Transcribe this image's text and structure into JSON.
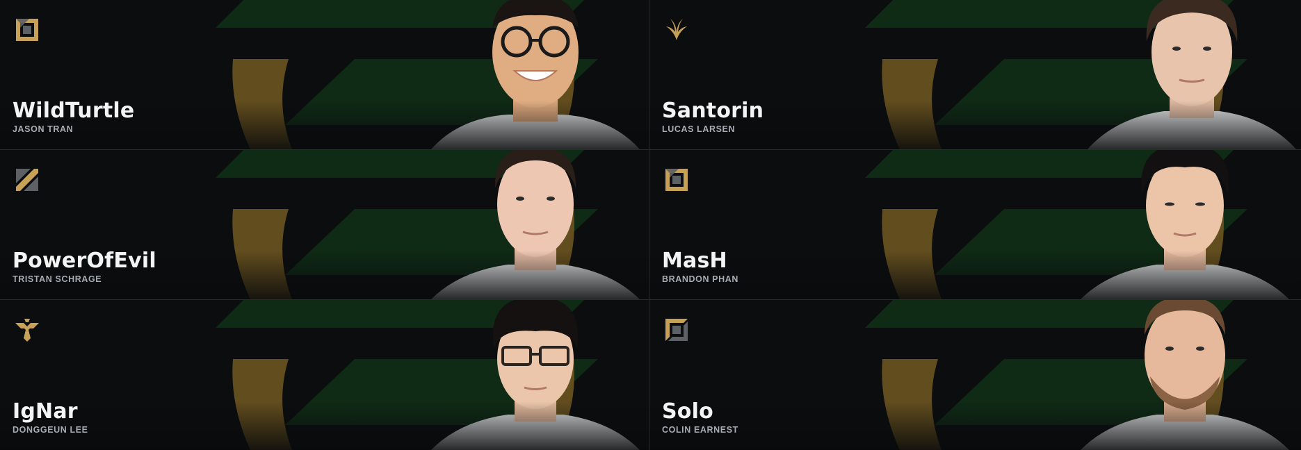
{
  "colors": {
    "gold": "#c7a158",
    "green": "#0f2a15",
    "background": "#0b0d0f",
    "name": "#f4f4f4",
    "realname": "#a7adb3"
  },
  "players": [
    {
      "handle": "WildTurtle",
      "real_name": "JASON TRAN",
      "role_icon": "bottom-lane-icon"
    },
    {
      "handle": "Santorin",
      "real_name": "LUCAS LARSEN",
      "role_icon": "jungle-icon"
    },
    {
      "handle": "PowerOfEvil",
      "real_name": "TRISTAN SCHRAGE",
      "role_icon": "mid-lane-icon"
    },
    {
      "handle": "MasH",
      "real_name": "BRANDON PHAN",
      "role_icon": "bottom-lane-icon"
    },
    {
      "handle": "IgNar",
      "real_name": "DONGGEUN LEE",
      "role_icon": "support-icon"
    },
    {
      "handle": "Solo",
      "real_name": "COLIN EARNEST",
      "role_icon": "top-lane-icon"
    }
  ]
}
